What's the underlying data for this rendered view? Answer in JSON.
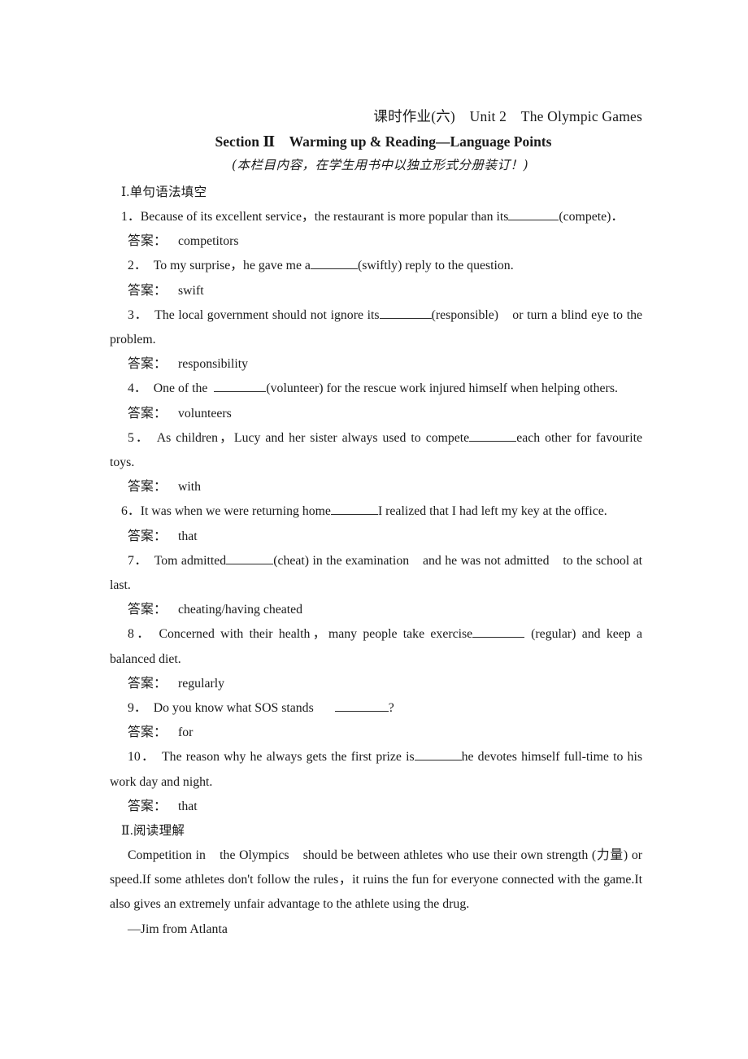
{
  "header": {
    "title": "课时作业(六)　Unit 2　The Olympic Games",
    "subtitle": "Section Ⅱ　Warming up & Reading—Language Points",
    "note": "(本栏目内容，在学生用书中以独立形式分册装订！)"
  },
  "sections": [
    {
      "heading": "Ⅰ.单句语法填空",
      "answer_label": "答案：",
      "items": [
        {
          "number": "1．",
          "text_before": "Because of its excellent service，the restaurant is more popular than its",
          "text_after": "(compete)．",
          "answer": "competitors"
        },
        {
          "number": "2．",
          "text_before": "To my surprise，he gave me a",
          "text_after": "(swiftly) reply to the question.",
          "answer": "swift"
        },
        {
          "number": "3．",
          "text_before": "The local government should not ignore its",
          "text_after": "(responsible)　or turn a blind eye to the problem.",
          "answer": "responsibility"
        },
        {
          "number": "4．",
          "text_before": "One of the",
          "text_after": "(volunteer) for the rescue work injured himself when helping others.",
          "answer": "volunteers"
        },
        {
          "number": "5．",
          "text_before": "As children，Lucy and her sister always used to compete",
          "text_after": "each other for favourite toys.",
          "answer": "with"
        },
        {
          "number": "6．",
          "text_before": "It was when we were returning home",
          "text_after": "I realized that I had left my key at the office.",
          "answer": "that"
        },
        {
          "number": "7．",
          "text_before": "Tom admitted",
          "text_after": "(cheat) in the examination　and he was not admitted　to the school at last.",
          "answer": "cheating/having cheated"
        },
        {
          "number": "8．",
          "text_before": "Concerned with their health，many people take exercise",
          "text_after": "(regular) and keep a balanced diet.",
          "answer": "regularly"
        },
        {
          "number": "9．",
          "text_before": "Do you know what SOS stands",
          "text_after": "?",
          "answer": "for"
        },
        {
          "number": "10．",
          "text_before": "The reason why he always gets the first prize is",
          "text_after": "he devotes himself full-time to his work day and night.",
          "answer": "that"
        }
      ]
    },
    {
      "heading": "Ⅱ.阅读理解",
      "passage": "Competition in　the Olympics　should be between athletes who use their own strength (力量) or speed.If some athletes don't follow the rules，it ruins the fun for everyone connected with the game.It also gives an extremely unfair advantage to the athlete using the drug.",
      "attribution": "—Jim from Atlanta"
    }
  ]
}
